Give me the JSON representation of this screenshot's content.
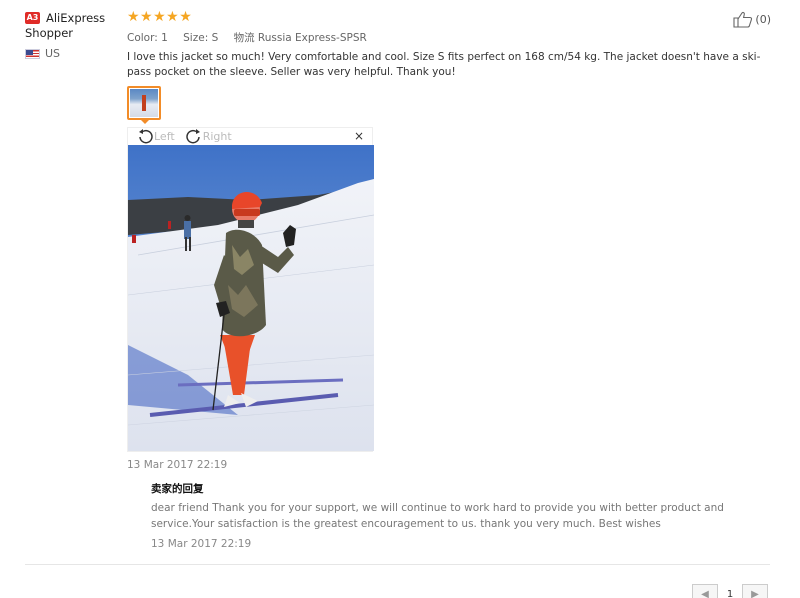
{
  "user": {
    "avatar_initials": "A3",
    "name_line1": "AliExpress",
    "name_line2": "Shopper",
    "country": "US"
  },
  "rating": {
    "stars_text": "★★★★★",
    "value": 5,
    "max": 5
  },
  "helpful": {
    "count_text": "(0)"
  },
  "attributes": {
    "color": "Color: 1",
    "size": "Size: S",
    "logistics": "物流 Russia Express-SPSR"
  },
  "feedback_text": "I love this jacket so much! Very comfortable and cool. Size S fits perfect on 168 cm/54 kg. The jacket doesn't have a ski-pass pocket on the sleeve. Seller was very helpful. Thank you!",
  "viewer": {
    "rotate_left_label": "Left",
    "rotate_right_label": "Right",
    "close_label": "×"
  },
  "review_date": "13 Mar 2017 22:19",
  "seller_reply": {
    "title": "卖家的回复",
    "text": "dear friend Thank you for your support, we will continue to work hard to provide you with better product and service.Your satisfaction is the greatest encouragement to us. thank you very much. Best wishes",
    "date": "13 Mar 2017 22:19"
  },
  "pagination": {
    "prev_label": "◀",
    "current_page": "1",
    "next_label": "▶"
  },
  "colors": {
    "star": "#f5a623",
    "thumb_border": "#f28c28",
    "avatar_bg": "#e02b27"
  }
}
